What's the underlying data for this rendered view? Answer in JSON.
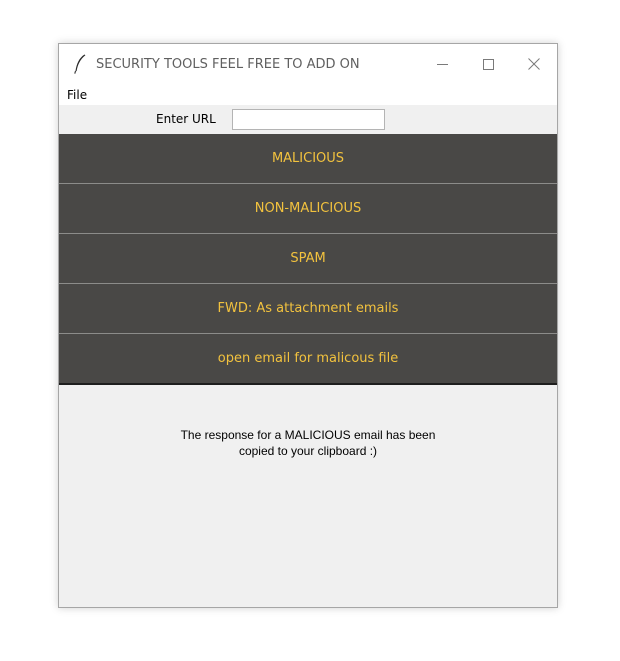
{
  "window": {
    "title": "SECURITY TOOLS FEEL FREE TO ADD ON",
    "app_icon": "feather-icon",
    "controls": [
      "minimize-icon",
      "maximize-icon",
      "close-icon"
    ]
  },
  "menu": {
    "items": [
      {
        "label": "File"
      }
    ]
  },
  "url": {
    "label": "Enter URL",
    "value": "",
    "placeholder": ""
  },
  "buttons": [
    {
      "label": "MALICIOUS"
    },
    {
      "label": "NON-MALICIOUS"
    },
    {
      "label": "SPAM"
    },
    {
      "label": "FWD: As attachment emails"
    },
    {
      "label": "open email for malicous file"
    }
  ],
  "message": {
    "line1": "The response for a MALICIOUS email has been",
    "line2": "copied to your clipboard :)"
  },
  "colors": {
    "button_bg": "#494846",
    "button_text": "#f2c23e",
    "window_bg": "#f0f0f0"
  }
}
